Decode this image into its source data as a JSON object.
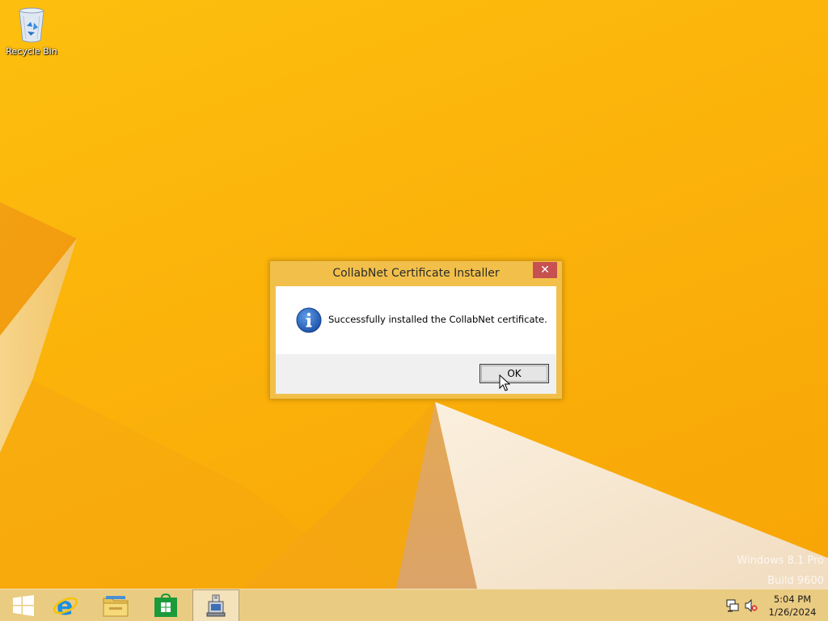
{
  "desktop": {
    "icons": [
      {
        "label": "Recycle Bin",
        "icon": "recycle-bin-icon"
      }
    ],
    "watermark": {
      "line1": "Windows 8.1 Pro",
      "line2": "Build 9600"
    },
    "colors": {
      "wallpaper_primary": "#fbb20a",
      "wallpaper_shape_light": "#f7ead6",
      "wallpaper_shape_orange": "#f29a10"
    }
  },
  "dialog": {
    "title": "CollabNet Certificate Installer",
    "close_label": "✕",
    "message": "Successfully installed the CollabNet certificate.",
    "icon": "info-icon",
    "ok_label": "OK",
    "colors": {
      "frame": "#f2c04a",
      "close_button": "#c75050"
    }
  },
  "taskbar": {
    "buttons": [
      {
        "name": "start-button",
        "icon": "windows-logo-icon"
      },
      {
        "name": "internet-explorer",
        "icon": "internet-explorer-icon"
      },
      {
        "name": "file-explorer",
        "icon": "file-explorer-icon"
      },
      {
        "name": "store",
        "icon": "store-icon"
      },
      {
        "name": "certificate-installer",
        "icon": "installer-app-icon",
        "active": true
      }
    ],
    "tray": {
      "network_icon": "network-icon",
      "volume_icon": "volume-muted-icon"
    },
    "clock": {
      "time": "5:04 PM",
      "date": "1/26/2024"
    }
  }
}
